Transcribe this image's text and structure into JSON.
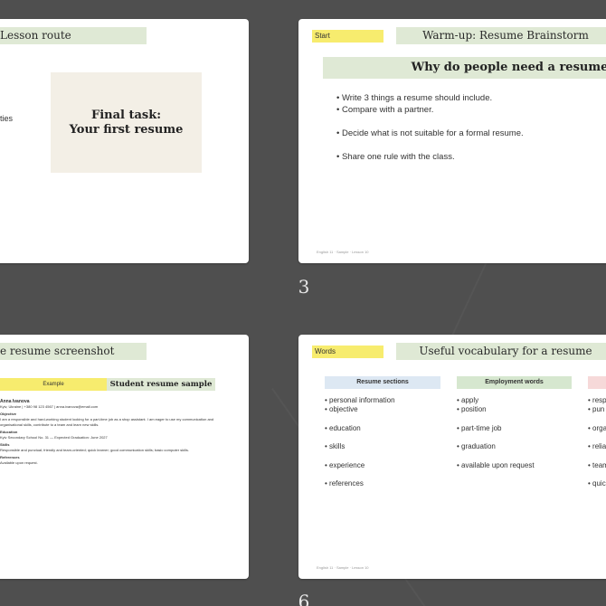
{
  "slides": [
    {
      "number": "",
      "title": "Lesson route",
      "left_text": "ties",
      "final_line1": "Final task:",
      "final_line2": "Your first resume"
    },
    {
      "number": "3",
      "tag": "Start",
      "title": "Warm-up: Resume Brainstorm",
      "question": "Why do people need a resume?",
      "bullets": [
        "Write 3 things a resume should include.",
        "Compare with a partner.",
        "Decide what is not suitable for a formal resume.",
        "Share one rule with the class."
      ],
      "footer": "English 11 · Sample · Lesson 10"
    },
    {
      "title": "e resume screenshot",
      "example_tag": "Example",
      "sample_heading": "Student resume sample",
      "resume": {
        "name": "Anna Ivanova",
        "contact": "Kyiv, Ukraine | +380 98 123 4567 | anna.ivanova@email.com",
        "objective_h": "Objective",
        "objective": "I am a responsible and hard-working student looking for a part-time job as a shop assistant. I am eager to use my communication and organisational skills, contribute to a team and learn new skills.",
        "education_h": "Education",
        "education": "Kyiv Secondary School No. 31 — Expected Graduation: June 2027",
        "skills_h": "Skills",
        "skills": "Responsible and punctual; friendly and team-oriented; quick learner; good communication skills; basic computer skills.",
        "references_h": "References",
        "references": "Available upon request."
      }
    },
    {
      "number": "6",
      "tag": "Words",
      "title": "Useful vocabulary for a resume",
      "columns": [
        {
          "heading": "Resume sections",
          "items": [
            "personal information",
            "objective",
            "education",
            "skills",
            "experience",
            "references"
          ]
        },
        {
          "heading": "Employment words",
          "items": [
            "apply",
            "position",
            "part-time job",
            "graduation",
            "available upon request"
          ]
        },
        {
          "heading": "",
          "items": [
            "resp",
            "pun",
            "orga",
            "relia",
            "team",
            "quic"
          ]
        }
      ],
      "footer": "English 11 · Sample · Lesson 10"
    }
  ],
  "colors": {
    "background": "#4f4f4f",
    "title_bar": "#dfe9d5",
    "tag_yellow": "#f7ec6e",
    "beige_box": "#f3efe6"
  }
}
